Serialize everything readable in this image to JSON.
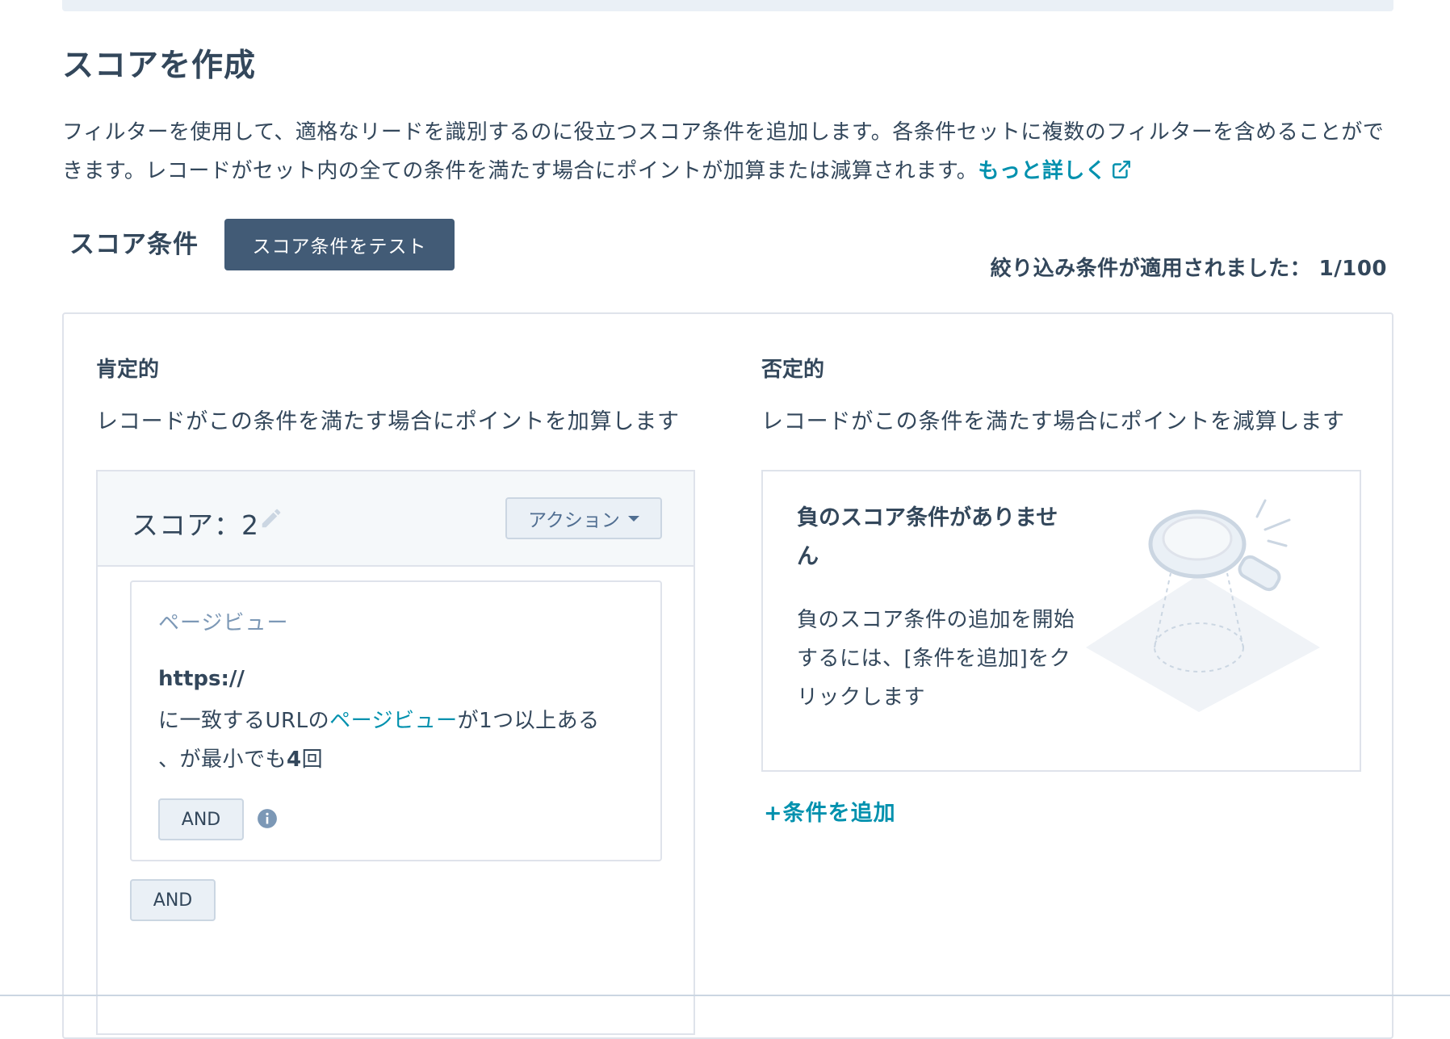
{
  "page": {
    "title": "スコアを作成",
    "description": "フィルターを使用して、適格なリードを識別するのに役立つスコア条件を追加します。各条件セットに複数のフィルターを含めることができます。レコードがセット内の全ての条件を満たす場合にポイントが加算または減算されます。",
    "learn_more": "もっと詳しく",
    "icons": {
      "external_link": "external-link-icon"
    }
  },
  "conditions": {
    "label": "スコア条件",
    "test_button": "スコア条件をテスト",
    "applied_label": "絞り込み条件が適用されました：",
    "applied_count": "1/100"
  },
  "positive": {
    "title": "肯定的",
    "description": "レコードがこの条件を満たす場合にポイントを加算します",
    "score_label": "スコア：2",
    "action_button": "アクション",
    "filter": {
      "type": "ページビュー",
      "url": "https://",
      "text_before": "に一致するURLの",
      "text_link": "ページビュー",
      "text_after": "が1つ以上ある 、が最小でも",
      "count": "4",
      "count_suffix": "回"
    },
    "and_inner": "AND",
    "and_outer": "AND"
  },
  "negative": {
    "title": "否定的",
    "description": "レコードがこの条件を満たす場合にポイントを減算します",
    "empty_title": "負のスコア条件がありません",
    "empty_description": "負のスコア条件の追加を開始するには、[条件を追加]をクリックします",
    "add_condition": "+条件を追加"
  },
  "colors": {
    "text": "#33475b",
    "link": "#0091ae",
    "primary_button": "#425b76",
    "border": "#dfe3eb",
    "muted": "#7c98b6"
  }
}
